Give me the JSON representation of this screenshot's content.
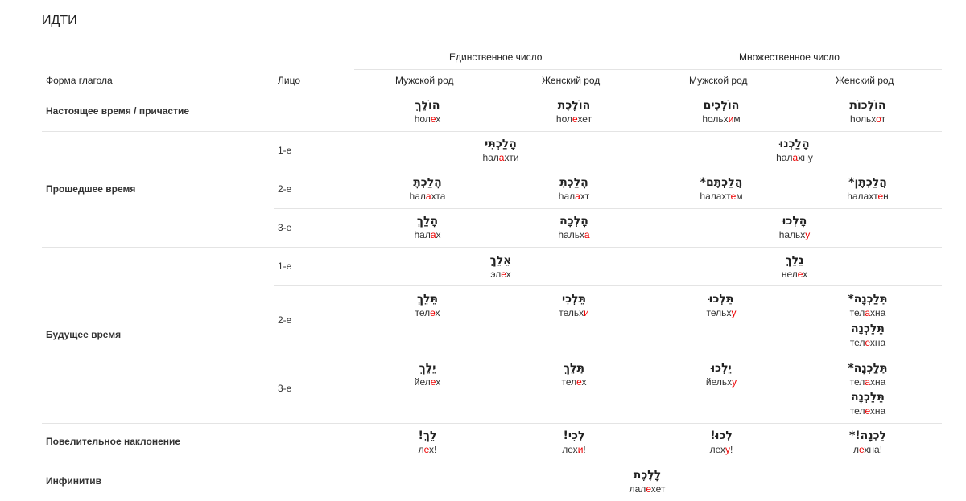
{
  "title": "ИДТИ",
  "header": {
    "singular": "Единственное число",
    "plural": "Множественное число",
    "form_col": "Форма глагола",
    "person_col": "Лицо",
    "masc": "Мужской род",
    "fem": "Женский род",
    "masc2": "Мужской род",
    "fem2": "Женский род"
  },
  "rows": {
    "present": "Настоящее время / причастие",
    "past": "Прошедшее время",
    "future": "Будущее время",
    "imperative": "Повелительное наклонение",
    "infinitive": "Инфинитив"
  },
  "persons": {
    "p1": "1-е",
    "p2": "2-е",
    "p3": "3-е",
    "f1": "1-е",
    "f2": "2-е",
    "f3": "3-е"
  },
  "cells": {
    "pres_ms": {
      "he": "הוֹלֵךְ",
      "t": [
        [
          "hо"
        ],
        [
          "л"
        ],
        [
          "е",
          1
        ],
        [
          "х"
        ]
      ]
    },
    "pres_fs": {
      "he": "הוֹלֶכֶת",
      "t": [
        [
          "hол"
        ],
        [
          "е",
          1
        ],
        [
          "хет"
        ]
      ]
    },
    "pres_mp": {
      "he": "הוֹלְכִים",
      "t": [
        [
          "hольх"
        ],
        [
          "и",
          1
        ],
        [
          "м"
        ]
      ]
    },
    "pres_fp": {
      "he": "הוֹלְכוֹת",
      "t": [
        [
          "hольх"
        ],
        [
          "о",
          1
        ],
        [
          "т"
        ]
      ]
    },
    "past1_s": {
      "he": "הָלַכְתִּי",
      "t": [
        [
          "hал"
        ],
        [
          "а",
          1
        ],
        [
          "хти"
        ]
      ]
    },
    "past1_p": {
      "he": "הָלַכְנוּ",
      "t": [
        [
          "hал"
        ],
        [
          "а",
          1
        ],
        [
          "хну"
        ]
      ]
    },
    "past2_ms": {
      "he": "הָלַכְתָּ",
      "t": [
        [
          "hал"
        ],
        [
          "а",
          1
        ],
        [
          "хта"
        ]
      ]
    },
    "past2_fs": {
      "he": "הָלַכְתְּ",
      "t": [
        [
          "hал"
        ],
        [
          "а",
          1
        ],
        [
          "хт"
        ]
      ]
    },
    "past2_mp": {
      "he": "הֲלַכְתֶּם*",
      "t": [
        [
          "hалахт"
        ],
        [
          "е",
          1
        ],
        [
          "м"
        ]
      ]
    },
    "past2_fp": {
      "he": "הֲלַכְתֶּן*",
      "t": [
        [
          "hалахт"
        ],
        [
          "е",
          1
        ],
        [
          "н"
        ]
      ]
    },
    "past3_ms": {
      "he": "הָלַךְ",
      "t": [
        [
          "hал"
        ],
        [
          "а",
          1
        ],
        [
          "х"
        ]
      ]
    },
    "past3_fs": {
      "he": "הָלְכָה",
      "t": [
        [
          "hальх"
        ],
        [
          "а",
          1
        ]
      ]
    },
    "past3_p": {
      "he": "הָלְכוּ",
      "t": [
        [
          "hальх"
        ],
        [
          "у",
          1
        ]
      ]
    },
    "fut1_s": {
      "he": "אֵלֵךְ",
      "t": [
        [
          "эл"
        ],
        [
          "е",
          1
        ],
        [
          "х"
        ]
      ]
    },
    "fut1_p": {
      "he": "נֵלֵךְ",
      "t": [
        [
          "нел"
        ],
        [
          "е",
          1
        ],
        [
          "х"
        ]
      ]
    },
    "fut2_ms": {
      "he": "תֵּלֵךְ",
      "t": [
        [
          "тел"
        ],
        [
          "е",
          1
        ],
        [
          "х"
        ]
      ]
    },
    "fut2_fs": {
      "he": "תֵּלְכִי",
      "t": [
        [
          "тельх"
        ],
        [
          "и",
          1
        ]
      ]
    },
    "fut2_mp": {
      "he": "תֵּלְכוּ",
      "t": [
        [
          "тельх"
        ],
        [
          "у",
          1
        ]
      ]
    },
    "fut2_fp_a": {
      "he": "תֵּלַכְנָה*",
      "t": [
        [
          "тел"
        ],
        [
          "а",
          1
        ],
        [
          "хна"
        ]
      ]
    },
    "fut2_fp_b": {
      "he": "תֵּלֵכְנָה",
      "t": [
        [
          "тел"
        ],
        [
          "е",
          1
        ],
        [
          "хна"
        ]
      ]
    },
    "fut3_ms": {
      "he": "יֵלֵךְ",
      "t": [
        [
          "йел"
        ],
        [
          "е",
          1
        ],
        [
          "х"
        ]
      ]
    },
    "fut3_fs": {
      "he": "תֵּלֵךְ",
      "t": [
        [
          "тел"
        ],
        [
          "е",
          1
        ],
        [
          "х"
        ]
      ]
    },
    "fut3_mp": {
      "he": "יֵלְכוּ",
      "t": [
        [
          "йельх"
        ],
        [
          "у",
          1
        ]
      ]
    },
    "fut3_fp_a": {
      "he": "תֵּלַכְנָה*",
      "t": [
        [
          "тел"
        ],
        [
          "а",
          1
        ],
        [
          "хна"
        ]
      ]
    },
    "fut3_fp_b": {
      "he": "תֵּלֵכְנָה",
      "t": [
        [
          "тел"
        ],
        [
          "е",
          1
        ],
        [
          "хна"
        ]
      ]
    },
    "imp_ms": {
      "he": "לֵךְ!",
      "t": [
        [
          "л"
        ],
        [
          "е",
          1
        ],
        [
          "х!"
        ]
      ]
    },
    "imp_fs": {
      "he": "לְכִי!",
      "t": [
        [
          "лех"
        ],
        [
          "и",
          1
        ],
        [
          "!"
        ]
      ]
    },
    "imp_mp": {
      "he": "לְכוּ!",
      "t": [
        [
          "лех"
        ],
        [
          "у",
          1
        ],
        [
          "!"
        ]
      ]
    },
    "imp_fp": {
      "he": "לֵכְנָה!*",
      "t": [
        [
          "л"
        ],
        [
          "е",
          1
        ],
        [
          "хна!"
        ]
      ]
    },
    "inf": {
      "he": "לָלֶכֶת",
      "t": [
        [
          "лал"
        ],
        [
          "е",
          1
        ],
        [
          "хет"
        ]
      ]
    }
  }
}
